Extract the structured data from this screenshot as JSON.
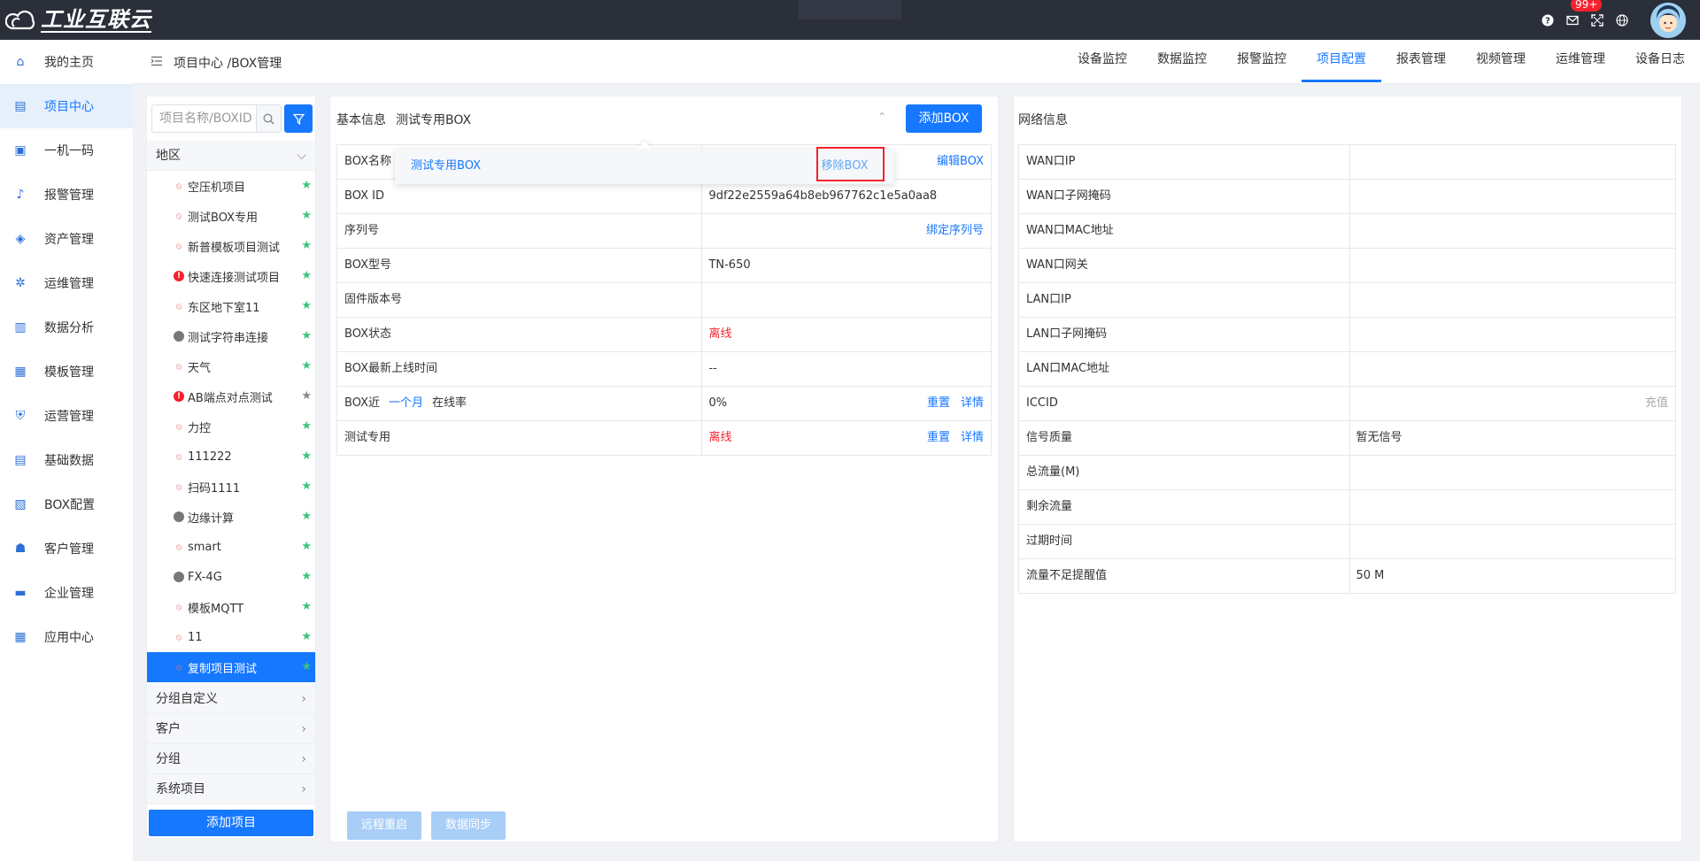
{
  "topbar": {
    "logo_text": "工业互联云",
    "badge": "99+"
  },
  "sidebar": {
    "items": [
      {
        "label": "我的主页",
        "icon": "home-icon"
      },
      {
        "label": "项目中心",
        "icon": "layers-icon"
      },
      {
        "label": "一机一码",
        "icon": "card-icon"
      },
      {
        "label": "报警管理",
        "icon": "bell-icon"
      },
      {
        "label": "资产管理",
        "icon": "asset-icon"
      },
      {
        "label": "运维管理",
        "icon": "gear-icon"
      },
      {
        "label": "数据分析",
        "icon": "chart-icon"
      },
      {
        "label": "模板管理",
        "icon": "template-icon"
      },
      {
        "label": "运营管理",
        "icon": "shield-icon"
      },
      {
        "label": "基础数据",
        "icon": "database-icon"
      },
      {
        "label": "BOX配置",
        "icon": "box-icon"
      },
      {
        "label": "客户管理",
        "icon": "users-icon"
      },
      {
        "label": "企业管理",
        "icon": "briefcase-icon"
      },
      {
        "label": "应用中心",
        "icon": "apps-icon"
      }
    ]
  },
  "breadcrumb": "项目中心 /BOX管理",
  "tabs": [
    "设备监控",
    "数据监控",
    "报警监控",
    "项目配置",
    "报表管理",
    "视频管理",
    "运维管理",
    "设备日志"
  ],
  "projects": {
    "search_placeholder": "项目名称/BOXID",
    "region_label": "地区",
    "items": [
      {
        "name": "空压机项目",
        "status": "link",
        "star": "green"
      },
      {
        "name": "测试BOX专用",
        "status": "link",
        "star": "green"
      },
      {
        "name": "新普模板项目测试",
        "status": "link",
        "star": "green"
      },
      {
        "name": "快速连接测试项目",
        "status": "err",
        "star": "green"
      },
      {
        "name": "东区地下室11",
        "status": "link",
        "star": "green"
      },
      {
        "name": "测试字符串连接",
        "status": "dot",
        "star": "green"
      },
      {
        "name": "天气",
        "status": "link",
        "star": "green"
      },
      {
        "name": "AB端点对点测试",
        "status": "err",
        "star": "gray"
      },
      {
        "name": "力控",
        "status": "link",
        "star": "green"
      },
      {
        "name": "111222",
        "status": "link",
        "star": "green"
      },
      {
        "name": "扫码1111",
        "status": "link",
        "star": "green"
      },
      {
        "name": "边缘计算",
        "status": "dot",
        "star": "green"
      },
      {
        "name": "smart",
        "status": "link",
        "star": "green"
      },
      {
        "name": "FX-4G",
        "status": "dot",
        "star": "green"
      },
      {
        "name": "模板MQTT",
        "status": "link",
        "star": "green"
      },
      {
        "name": "11",
        "status": "link",
        "star": "green"
      },
      {
        "name": "复制项目测试",
        "status": "link",
        "star": "green"
      }
    ],
    "groups": [
      "分组自定义",
      "客户",
      "分组",
      "系统项目"
    ],
    "add_label": "添加项目"
  },
  "basic": {
    "label": "基本信息",
    "selected_box": "测试专用BOX",
    "add_box": "添加BOX",
    "dropdown_item": "测试专用BOX",
    "dropdown_remove": "移除BOX",
    "rows": [
      {
        "label": "BOX名称",
        "value": "",
        "action": "编辑BOX"
      },
      {
        "label": "BOX ID",
        "value": "9df22e2559a64b8eb967762c1e5a0aa8"
      },
      {
        "label": "序列号",
        "value": "",
        "action": "绑定序列号"
      },
      {
        "label": "BOX型号",
        "value": "TN-650"
      },
      {
        "label": "固件版本号",
        "value": ""
      },
      {
        "label": "BOX状态",
        "value": "离线"
      },
      {
        "label": "BOX最新上线时间",
        "value": "--"
      }
    ],
    "rate_row": {
      "prefix": "BOX近",
      "period": "一个月",
      "suffix": "在线率",
      "value": "0%",
      "reset": "重置",
      "detail": "详情"
    },
    "test_row": {
      "label": "测试专用",
      "value": "离线",
      "reset": "重置",
      "detail": "详情"
    },
    "remote_restart": "远程重启",
    "data_sync": "数据同步"
  },
  "network": {
    "title": "网络信息",
    "rows": [
      {
        "label": "WAN口IP",
        "value": ""
      },
      {
        "label": "WAN口子网掩码",
        "value": ""
      },
      {
        "label": "WAN口MAC地址",
        "value": ""
      },
      {
        "label": "WAN口网关",
        "value": ""
      },
      {
        "label": "LAN口IP",
        "value": ""
      },
      {
        "label": "LAN口子网掩码",
        "value": ""
      },
      {
        "label": "LAN口MAC地址",
        "value": ""
      },
      {
        "label": "ICCID",
        "value": "",
        "action": "充值"
      },
      {
        "label": "信号质量",
        "value": "暂无信号"
      },
      {
        "label": "总流量(M)",
        "value": ""
      },
      {
        "label": "剩余流量",
        "value": ""
      },
      {
        "label": "过期时间",
        "value": ""
      },
      {
        "label": "流量不足提醒值",
        "value": "50 M",
        "highlight": true
      }
    ]
  }
}
